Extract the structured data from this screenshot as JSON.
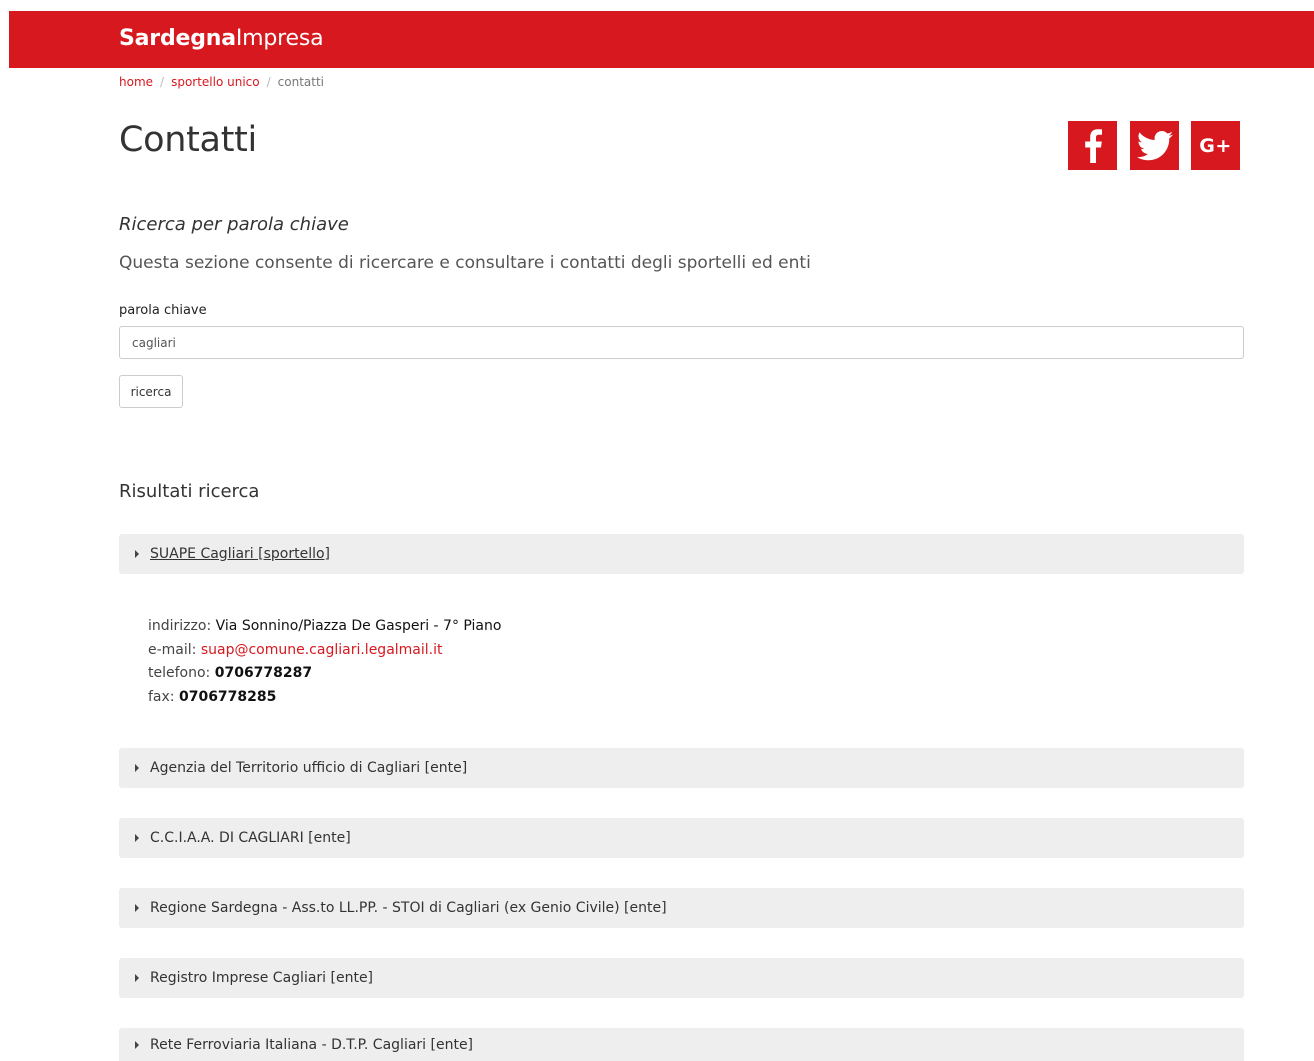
{
  "header": {
    "brand_bold": "Sardegna",
    "brand_light": "Impresa"
  },
  "breadcrumb": {
    "items": [
      "home",
      "sportello unico"
    ],
    "current": "contatti",
    "separator": "/"
  },
  "page": {
    "title": "Contatti"
  },
  "social": [
    {
      "name": "facebook",
      "icon": "facebook-icon"
    },
    {
      "name": "twitter",
      "icon": "twitter-icon"
    },
    {
      "name": "google-plus",
      "icon": "google-plus-icon",
      "glyph": "G+"
    }
  ],
  "search": {
    "heading": "Ricerca per parola chiave",
    "description": "Questa sezione consente di ricercare e consultare i contatti degli sportelli ed enti",
    "field_label": "parola chiave",
    "value": "cagliari",
    "button_label": "ricerca"
  },
  "results": {
    "heading": "Risultati ricerca",
    "items": [
      {
        "title": "SUAPE Cagliari [sportello]",
        "expanded": true
      },
      {
        "title": "Agenzia del Territorio ufficio di Cagliari [ente]",
        "expanded": false
      },
      {
        "title": "C.C.I.A.A. DI CAGLIARI [ente]",
        "expanded": false
      },
      {
        "title": "Regione Sardegna - Ass.to LL.PP. - STOI di Cagliari (ex Genio Civile) [ente]",
        "expanded": false
      },
      {
        "title": "Registro Imprese Cagliari [ente]",
        "expanded": false
      },
      {
        "title": "Rete Ferroviaria Italiana - D.T.P. Cagliari [ente]",
        "expanded": false
      }
    ],
    "detail": {
      "address_label": "indirizzo:",
      "address": "Via Sonnino/Piazza De Gasperi - 7° Piano",
      "email_label": "e-mail:",
      "email": "suap@comune.cagliari.legalmail.it",
      "phone_label": "telefono:",
      "phone": "0706778287",
      "fax_label": "fax:",
      "fax": "0706778285"
    }
  },
  "colors": {
    "brand": "#d7191f",
    "panel": "#eeeeee",
    "text": "#333333"
  }
}
